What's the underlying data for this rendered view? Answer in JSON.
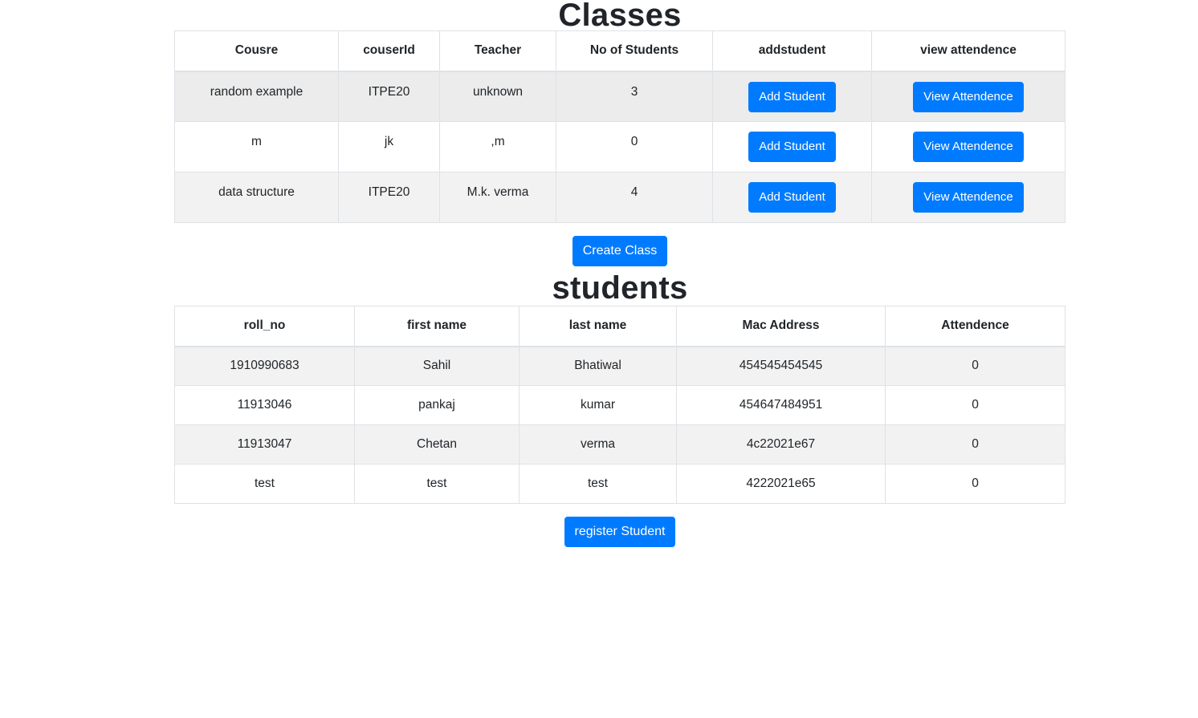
{
  "classes": {
    "title": "Classes",
    "columns": [
      "Cousre",
      "couserId",
      "Teacher",
      "No of Students",
      "addstudent",
      "view attendence"
    ],
    "rows": [
      {
        "course": "random example",
        "course_id": "ITPE20",
        "teacher": "unknown",
        "num_students": "3",
        "add_label": "Add Student",
        "view_label": "View Attendence"
      },
      {
        "course": "m",
        "course_id": "jk",
        "teacher": ",m",
        "num_students": "0",
        "add_label": "Add Student",
        "view_label": "View Attendence"
      },
      {
        "course": "data structure",
        "course_id": "ITPE20",
        "teacher": "M.k. verma",
        "num_students": "4",
        "add_label": "Add Student",
        "view_label": "View Attendence"
      }
    ],
    "create_label": "Create Class"
  },
  "students": {
    "title": "students",
    "columns": [
      "roll_no",
      "first name",
      "last name",
      "Mac Address",
      "Attendence"
    ],
    "rows": [
      {
        "roll_no": "1910990683",
        "first_name": "Sahil",
        "last_name": "Bhatiwal",
        "mac": "454545454545",
        "attendence": "0"
      },
      {
        "roll_no": "11913046",
        "first_name": "pankaj",
        "last_name": "kumar",
        "mac": "454647484951",
        "attendence": "0"
      },
      {
        "roll_no": "11913047",
        "first_name": "Chetan",
        "last_name": "verma",
        "mac": "4c22021e67",
        "attendence": "0"
      },
      {
        "roll_no": "test",
        "first_name": "test",
        "last_name": "test",
        "mac": "4222021e65",
        "attendence": "0"
      }
    ],
    "register_label": "register Student"
  },
  "colors": {
    "primary": "#007bff",
    "stripe": "#f2f2f2",
    "border": "#dee2e6",
    "text": "#212529"
  }
}
